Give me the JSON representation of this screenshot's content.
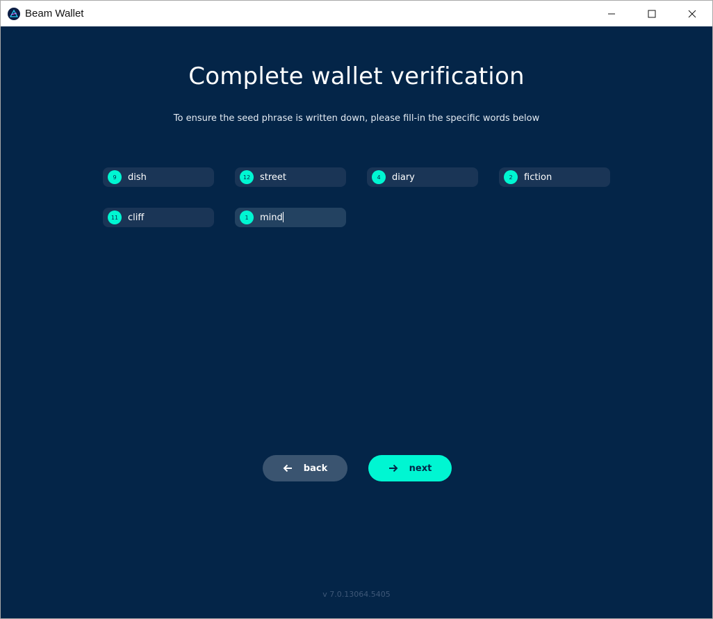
{
  "window": {
    "title": "Beam Wallet",
    "controls": [
      "minimize",
      "maximize",
      "close"
    ]
  },
  "page": {
    "heading": "Complete wallet verification",
    "subtitle": "To ensure the seed phrase is written down, please fill-in the specific words below"
  },
  "words": [
    {
      "number": "9",
      "value": "dish"
    },
    {
      "number": "12",
      "value": "street"
    },
    {
      "number": "4",
      "value": "diary"
    },
    {
      "number": "2",
      "value": "fiction"
    },
    {
      "number": "11",
      "value": "cliff"
    },
    {
      "number": "1",
      "value": "mind"
    }
  ],
  "buttons": {
    "back_label": "back",
    "next_label": "next"
  },
  "footer": {
    "version": "v 7.0.13064.5405"
  },
  "colors": {
    "background": "#042548",
    "accent": "#00f6d2",
    "field": "#1a3556",
    "back_button": "#3a5470"
  },
  "icons": {
    "back": "arrow-left-icon",
    "next": "arrow-right-icon",
    "app": "beam-logo-icon"
  }
}
